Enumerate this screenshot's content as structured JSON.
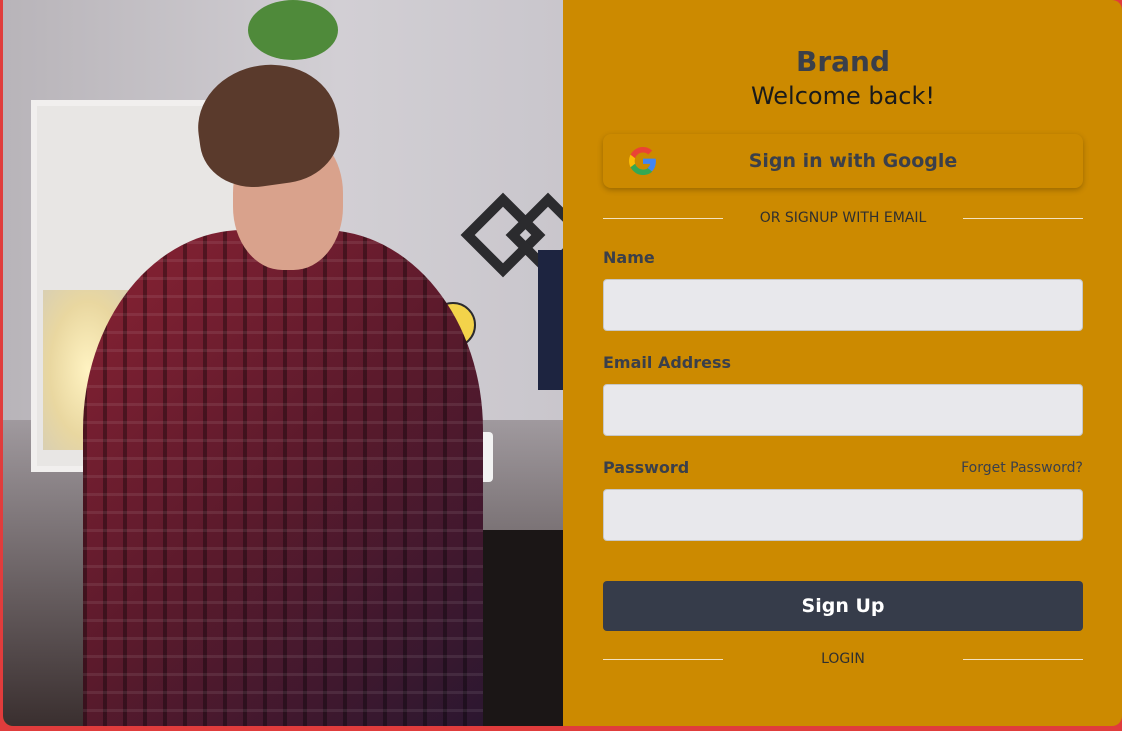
{
  "brand": "Brand",
  "welcome": "Welcome back!",
  "google_button": {
    "label": "Sign in with Google",
    "icon": "google-icon"
  },
  "divider_signup": "OR SIGNUP WITH EMAIL",
  "fields": {
    "name": {
      "label": "Name",
      "value": ""
    },
    "email": {
      "label": "Email Address",
      "value": ""
    },
    "password": {
      "label": "Password",
      "value": ""
    }
  },
  "forgot_password": "Forget Password?",
  "signup_button": "Sign Up",
  "divider_login": "LOGIN",
  "colors": {
    "panel": "#cc8a00",
    "button": "#363c4a",
    "input": "#e8e8ec",
    "frame": "#e03c3c"
  }
}
